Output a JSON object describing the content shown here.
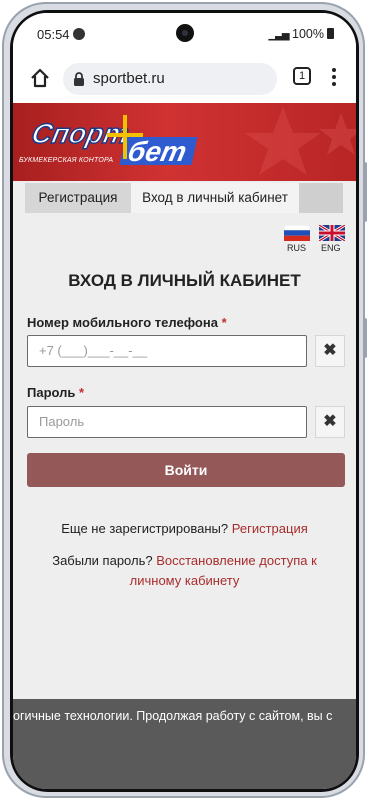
{
  "status": {
    "time": "05:54",
    "battery": "100%"
  },
  "browser": {
    "url": "sportbet.ru",
    "tab_count": "1"
  },
  "brand": {
    "tagline": "БУКМЕКЕРСКАЯ КОНТОРА",
    "logo_text": "Спорт бет"
  },
  "tabs": {
    "register": "Регистрация",
    "login": "Вход в личный кабинет"
  },
  "languages": [
    {
      "code": "RUS"
    },
    {
      "code": "ENG"
    }
  ],
  "form": {
    "title": "ВХОД В ЛИЧНЫЙ КАБИНЕТ",
    "phone_label": "Номер мобильного телефона",
    "phone_placeholder": "+7 (___)___-__-__",
    "password_label": "Пароль",
    "password_placeholder": "Пароль",
    "required_mark": "*",
    "submit": "Войти"
  },
  "links": {
    "not_registered": "Еще не зарегистрированы?",
    "register": "Регистрация",
    "forgot": "Забыли пароль?",
    "restore_line1": "Восстановление доступа к",
    "restore_line2": "личному кабинету"
  },
  "cookie_text": "огичные технологии. Продолжая работу с сайтом, вы с",
  "colors": {
    "brand_red": "#c02a2a",
    "button": "#955858",
    "link": "#a92c2c"
  }
}
